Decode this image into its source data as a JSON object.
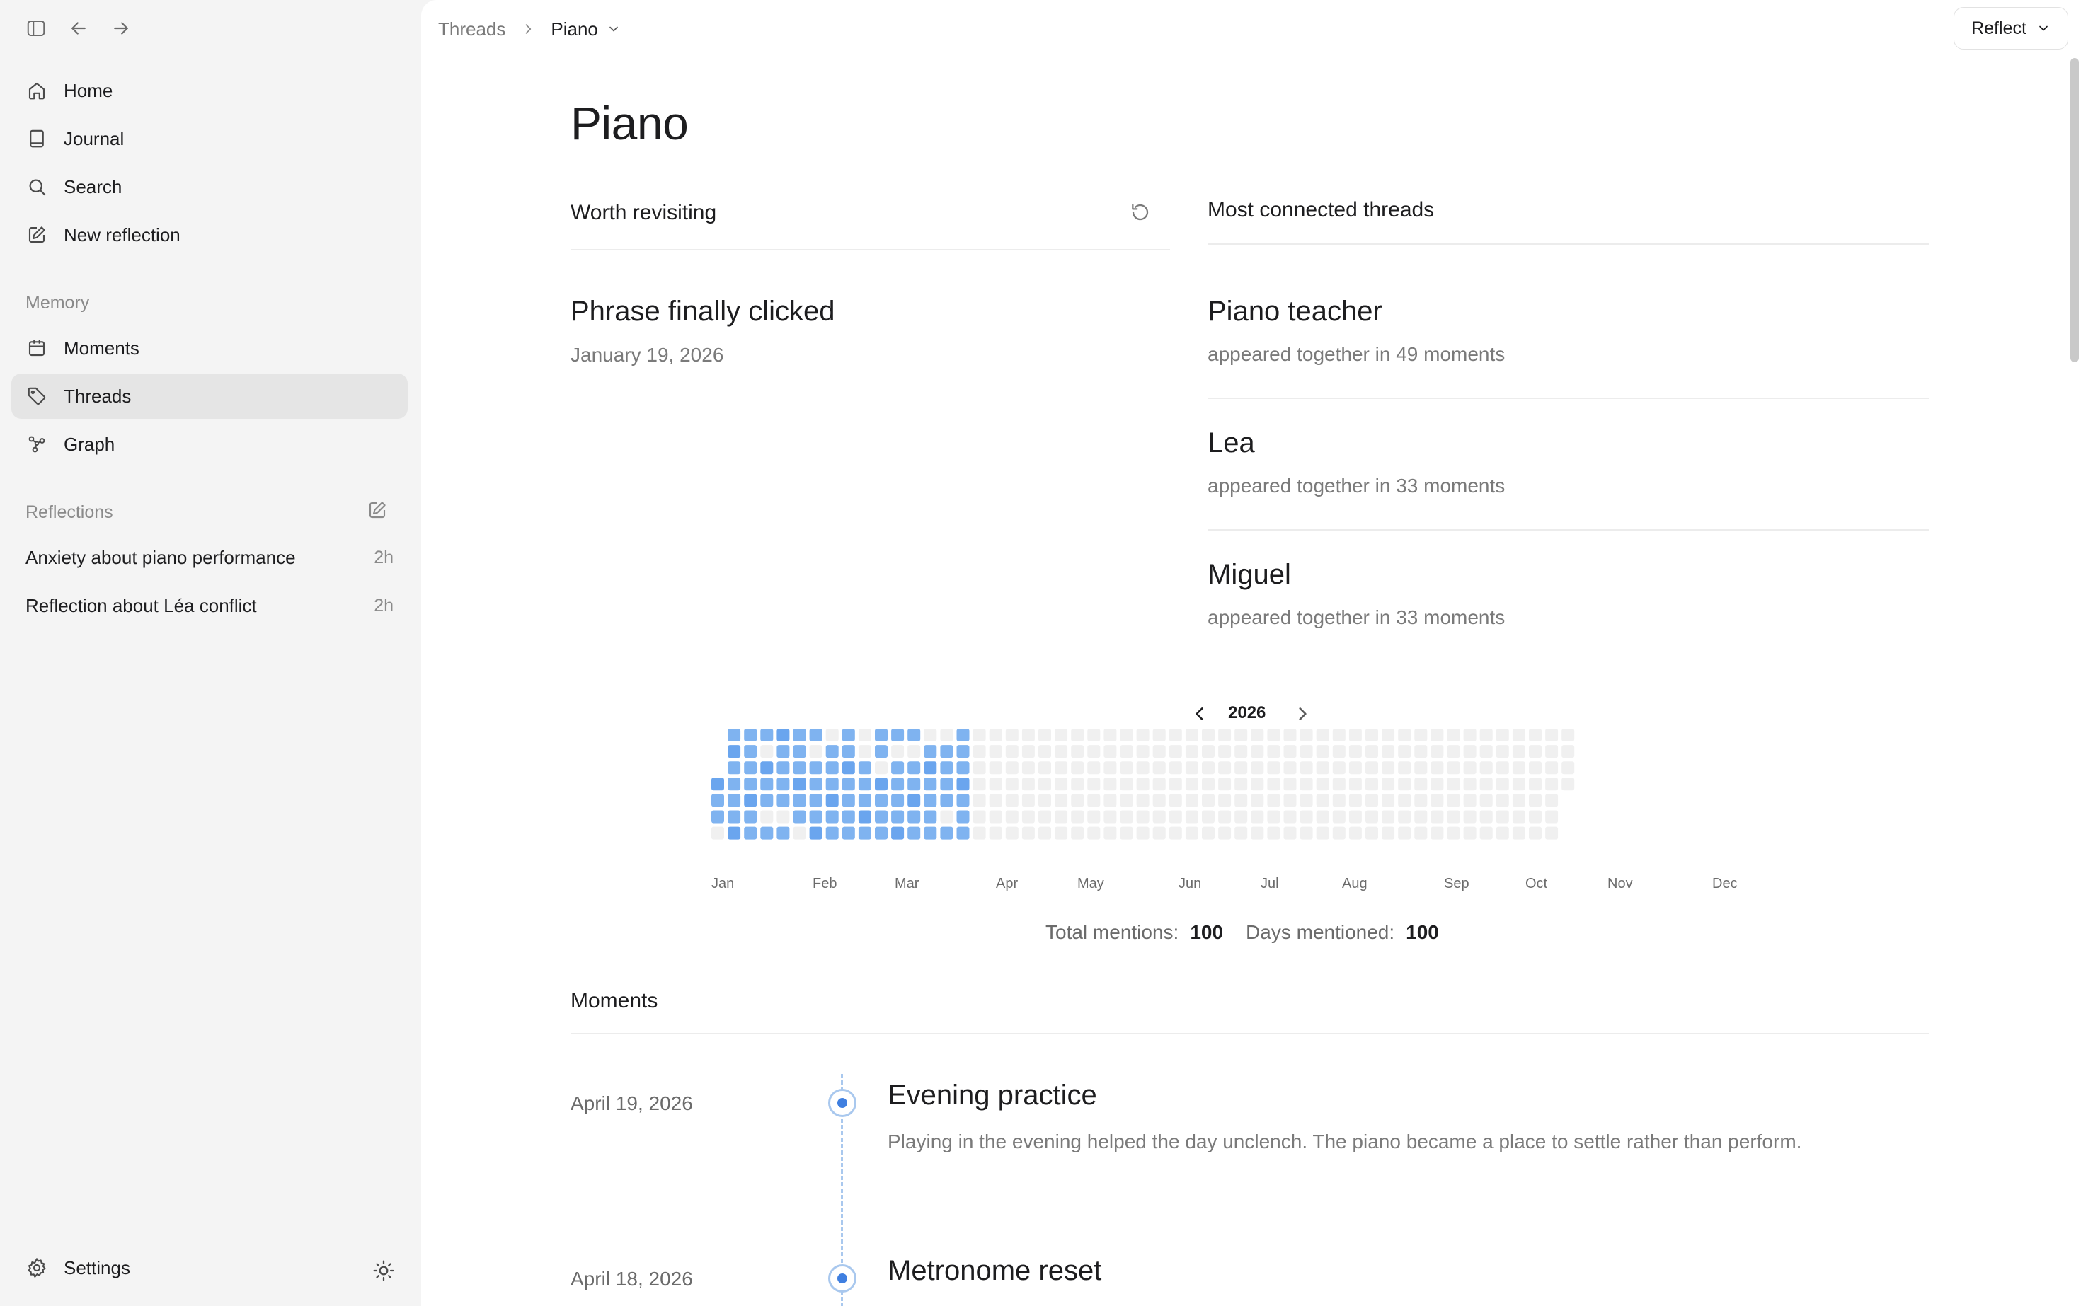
{
  "sidebar": {
    "nav": [
      {
        "label": "Home",
        "icon": "home-icon"
      },
      {
        "label": "Journal",
        "icon": "book-icon"
      },
      {
        "label": "Search",
        "icon": "search-icon"
      },
      {
        "label": "New reflection",
        "icon": "compose-icon"
      }
    ],
    "memory_heading": "Memory",
    "memory": [
      {
        "label": "Moments",
        "icon": "calendar-icon"
      },
      {
        "label": "Threads",
        "icon": "tag-icon",
        "active": true
      },
      {
        "label": "Graph",
        "icon": "graph-icon"
      }
    ],
    "reflections_heading": "Reflections",
    "reflections": [
      {
        "title": "Anxiety about piano performance",
        "age": "2h"
      },
      {
        "title": "Reflection about Léa conflict",
        "age": "2h"
      }
    ],
    "settings_label": "Settings"
  },
  "header": {
    "breadcrumb_parent": "Threads",
    "breadcrumb_current": "Piano",
    "reflect_label": "Reflect"
  },
  "page": {
    "title": "Piano",
    "worth_revisiting": {
      "heading": "Worth revisiting",
      "item_title": "Phrase finally clicked",
      "item_date": "January 19, 2026"
    },
    "connected": {
      "heading": "Most connected threads",
      "items": [
        {
          "name": "Piano teacher",
          "sub": "appeared together in 49 moments"
        },
        {
          "name": "Lea",
          "sub": "appeared together in 33 moments"
        },
        {
          "name": "Miguel",
          "sub": "appeared together in 33 moments"
        }
      ]
    },
    "activity": {
      "year": "2026",
      "months": [
        "Jan",
        "Feb",
        "Mar",
        "Apr",
        "May",
        "Jun",
        "Jul",
        "Aug",
        "Sep",
        "Oct",
        "Nov",
        "Dec"
      ],
      "total_label": "Total mentions:",
      "total_value": "100",
      "days_label": "Days mentioned:",
      "days_value": "100",
      "colors": {
        "active": "#7fb3f0",
        "active_strong": "#6aa5ee",
        "empty": "#f0f0f0"
      }
    },
    "moments": {
      "heading": "Moments",
      "items": [
        {
          "date": "April 19, 2026",
          "title": "Evening practice",
          "desc": "Playing in the evening helped the day unclench. The piano became a place to settle rather than perform."
        },
        {
          "date": "April 18, 2026",
          "title": "Metronome reset",
          "desc": ""
        }
      ]
    }
  }
}
